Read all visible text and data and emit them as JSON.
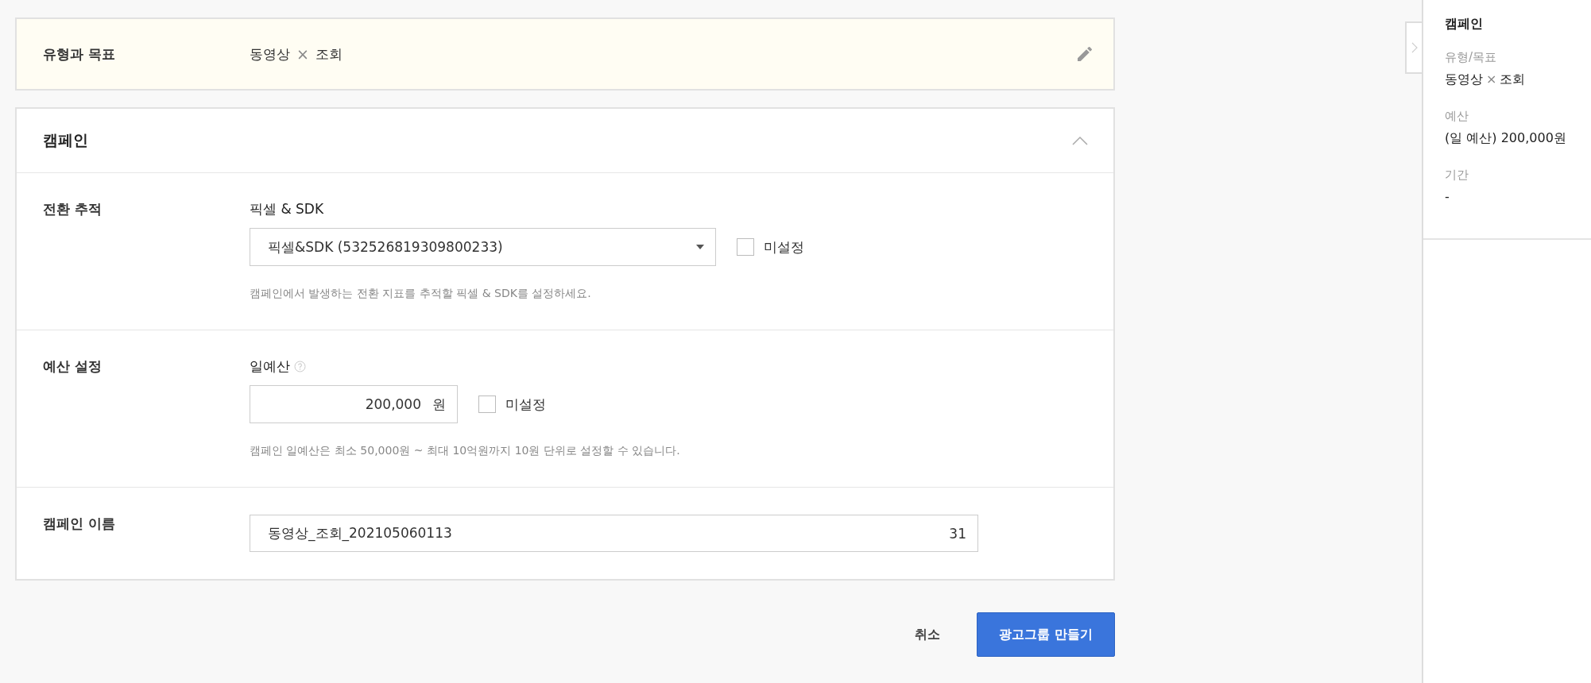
{
  "objective": {
    "label": "유형과 목표",
    "type": "동영상",
    "separator": "×",
    "goal": "조회"
  },
  "campaign": {
    "title": "캠페인",
    "expanded": true,
    "rows": [
      {
        "kind": "select",
        "label": "전환 추적",
        "field_label": "픽셀 & SDK",
        "value": "픽셀&SDK (532526819309800233)",
        "unset_label": "미설정",
        "unset_checked": false,
        "hint": "캠페인에서 발생하는 전환 지표를 추적할 픽셀 & SDK를 설정하세요."
      },
      {
        "kind": "amount",
        "label": "예산 설정",
        "field_label": "일예산",
        "value": "200,000",
        "unit": "원",
        "unset_label": "미설정",
        "unset_checked": false,
        "hint": "캠페인 일예산은 최소 50,000원 ~ 최대 10억원까지 10원 단위로 설정할 수 있습니다."
      },
      {
        "kind": "text",
        "label": "캠페인 이름",
        "value": "동영상_조회_202105060113",
        "counter": "31"
      }
    ]
  },
  "actions": {
    "cancel": "취소",
    "submit": "광고그룹 만들기"
  },
  "summary": {
    "title": "캠페인",
    "items": [
      {
        "label": "유형/목표",
        "type": "동영상",
        "separator": "×",
        "goal": "조회"
      },
      {
        "label": "예산",
        "value": "(일 예산) 200,000원"
      },
      {
        "label": "기간",
        "value": "-"
      }
    ]
  }
}
